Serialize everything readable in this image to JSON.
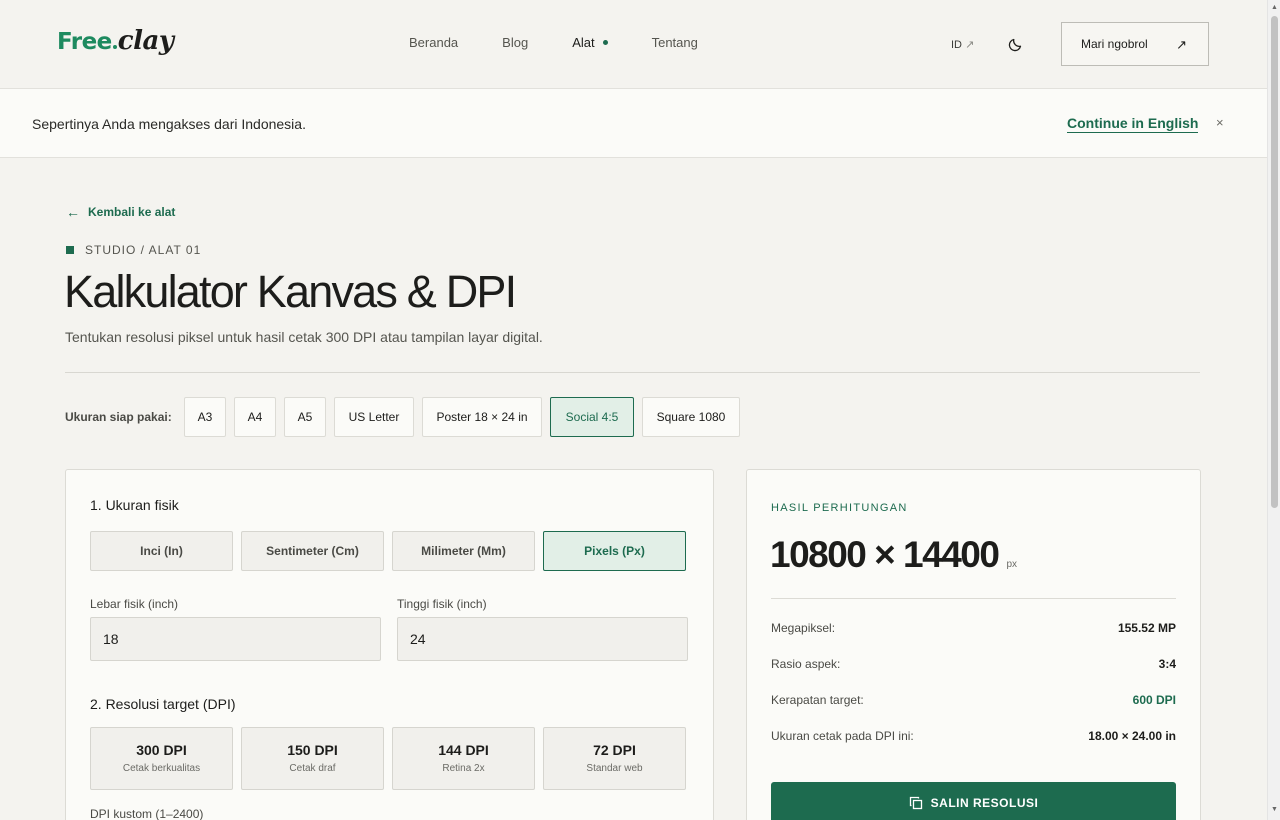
{
  "header": {
    "logo_free": "Free",
    "logo_clay": "clay",
    "nav": [
      {
        "label": "Beranda"
      },
      {
        "label": "Blog"
      },
      {
        "label": "Alat"
      },
      {
        "label": "Tentang"
      }
    ],
    "lang_label": "ID",
    "lang_arrow": "↗",
    "chat_label": "Mari ngobrol",
    "chat_arrow": "↗"
  },
  "banner": {
    "text": "Sepertinya Anda mengakses dari Indonesia.",
    "link": "Continue in English",
    "close": "×"
  },
  "page": {
    "back": "Kembali ke alat",
    "back_arrow": "←",
    "eyebrow": "STUDIO / ALAT 01",
    "title": "Kalkulator Kanvas & DPI",
    "subtitle": "Tentukan resolusi piksel untuk hasil cetak 300 DPI atau tampilan layar digital."
  },
  "presets": {
    "label": "Ukuran siap pakai:",
    "items": [
      {
        "label": "A3"
      },
      {
        "label": "A4"
      },
      {
        "label": "A5"
      },
      {
        "label": "US Letter"
      },
      {
        "label": "Poster 18 × 24 in"
      },
      {
        "label": "Social 4:5",
        "active": true
      },
      {
        "label": "Square 1080"
      }
    ]
  },
  "size_section": {
    "title": "1. Ukuran fisik",
    "units": [
      {
        "label": "Inci (In)"
      },
      {
        "label": "Sentimeter (Cm)"
      },
      {
        "label": "Milimeter (Mm)"
      },
      {
        "label": "Pixels (Px)",
        "active": true
      }
    ],
    "width_label": "Lebar fisik (inch)",
    "width_value": "18",
    "height_label": "Tinggi fisik (inch)",
    "height_value": "24"
  },
  "dpi_section": {
    "title": "2. Resolusi target (DPI)",
    "options": [
      {
        "value": "300 DPI",
        "sub": "Cetak berkualitas"
      },
      {
        "value": "150 DPI",
        "sub": "Cetak draf"
      },
      {
        "value": "144 DPI",
        "sub": "Retina 2x"
      },
      {
        "value": "72 DPI",
        "sub": "Standar web"
      }
    ],
    "custom_label": "DPI kustom (1–2400)"
  },
  "result": {
    "label": "HASIL PERHITUNGAN",
    "value": "10800 × 14400",
    "unit": "px",
    "stats": [
      {
        "key": "Megapiksel:",
        "value": "155.52 MP"
      },
      {
        "key": "Rasio aspek:",
        "value": "3:4"
      },
      {
        "key": "Kerapatan target:",
        "value": "600 DPI"
      },
      {
        "key": "Ukuran cetak pada DPI ini:",
        "value": "18.00 × 24.00 in"
      }
    ],
    "copy_label": "SALIN RESOLUSI"
  },
  "colors": {
    "accent": "#1d6b4f",
    "logo_green": "#1d8a5f",
    "background": "#f4f3ef"
  }
}
